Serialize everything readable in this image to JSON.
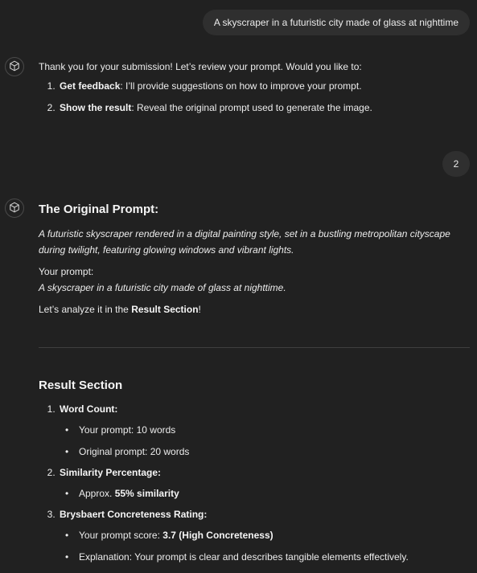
{
  "user_messages": [
    "A skyscraper in a futuristic city made of glass at nighttime",
    "2"
  ],
  "reply1": {
    "intro": "Thank you for your submission! Let’s review your prompt. Would you like to:",
    "options": [
      {
        "bold": "Get feedback",
        "text": ": I’ll provide suggestions on how to improve your prompt."
      },
      {
        "bold": "Show the result",
        "text": ": Reveal the original prompt used to generate the image."
      }
    ]
  },
  "reply2": {
    "heading": "The Original Prompt:",
    "original_prompt": "A futuristic skyscraper rendered in a digital painting style, set in a bustling metropolitan cityscape during twilight, featuring glowing windows and vibrant lights.",
    "your_prompt_label": "Your prompt:",
    "your_prompt": "A skyscraper in a futuristic city made of glass at nighttime.",
    "analyze_prefix": "Let’s analyze it in the ",
    "analyze_bold": "Result Section",
    "analyze_suffix": "!",
    "result_heading": "Result Section",
    "items": [
      {
        "title": "Word Count:",
        "bullets": [
          {
            "text": "Your prompt: 10 words"
          },
          {
            "text": "Original prompt: 20 words"
          }
        ]
      },
      {
        "title": "Similarity Percentage:",
        "bullets": [
          {
            "text": "Approx. ",
            "bold": "55% similarity"
          }
        ]
      },
      {
        "title": "Brysbaert Concreteness Rating:",
        "bullets": [
          {
            "text": "Your prompt score: ",
            "bold": "3.7 (High Concreteness)"
          },
          {
            "text": "Explanation: Your prompt is clear and describes tangible elements effectively."
          }
        ]
      }
    ]
  },
  "icons": {
    "assistant_avatar": "cube-icon"
  }
}
